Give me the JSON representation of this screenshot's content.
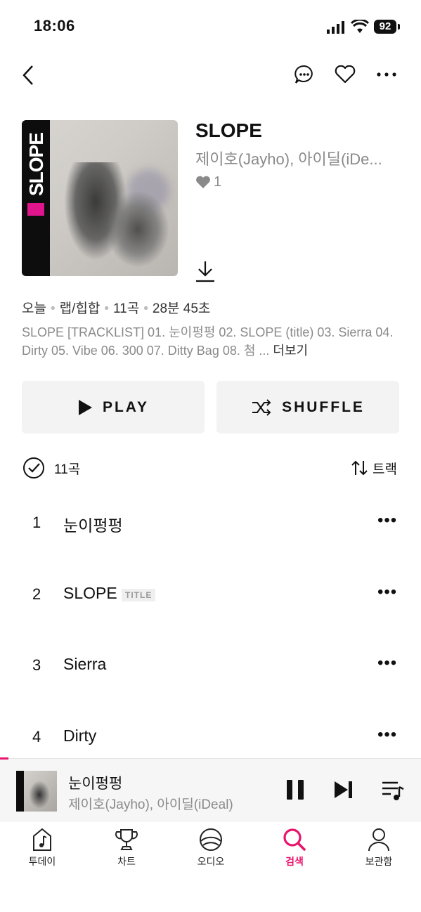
{
  "status": {
    "time": "18:06",
    "battery": "92"
  },
  "album": {
    "art_text": "SLOPE",
    "title": "SLOPE",
    "artist": "제이호(Jayho), 아이딜(iDe...",
    "likes": "1"
  },
  "meta": {
    "when": "오늘",
    "genre": "랩/힙합",
    "tracks": "11곡",
    "duration": "28분 45초"
  },
  "description": {
    "text": "SLOPE [TRACKLIST] 01. 눈이펑펑 02. SLOPE (title) 03. Sierra 04. Dirty 05. Vibe 06. 300 07. Ditty Bag 08. 첨 ...",
    "more": " 더보기"
  },
  "buttons": {
    "play": "PLAY",
    "shuffle": "SHUFFLE"
  },
  "list_header": {
    "count": "11곡",
    "sort": "트랙"
  },
  "tracks": [
    {
      "num": "1",
      "name": "눈이펑펑",
      "badge": ""
    },
    {
      "num": "2",
      "name": "SLOPE",
      "badge": "TITLE"
    },
    {
      "num": "3",
      "name": "Sierra",
      "badge": ""
    },
    {
      "num": "4",
      "name": "Dirty",
      "badge": ""
    }
  ],
  "more_glyph": "•••",
  "mini_player": {
    "title": "눈이펑펑",
    "artist": "제이호(Jayho), 아이딜(iDeal)"
  },
  "tabs": [
    {
      "label": "투데이",
      "icon": "music-note-icon"
    },
    {
      "label": "차트",
      "icon": "trophy-icon"
    },
    {
      "label": "오디오",
      "icon": "audio-icon"
    },
    {
      "label": "검색",
      "icon": "search-icon",
      "active": true
    },
    {
      "label": "보관함",
      "icon": "person-icon"
    }
  ],
  "colors": {
    "accent": "#e8156d",
    "secondary_text": "#8a8a8a",
    "button_bg": "#f3f3f3"
  }
}
